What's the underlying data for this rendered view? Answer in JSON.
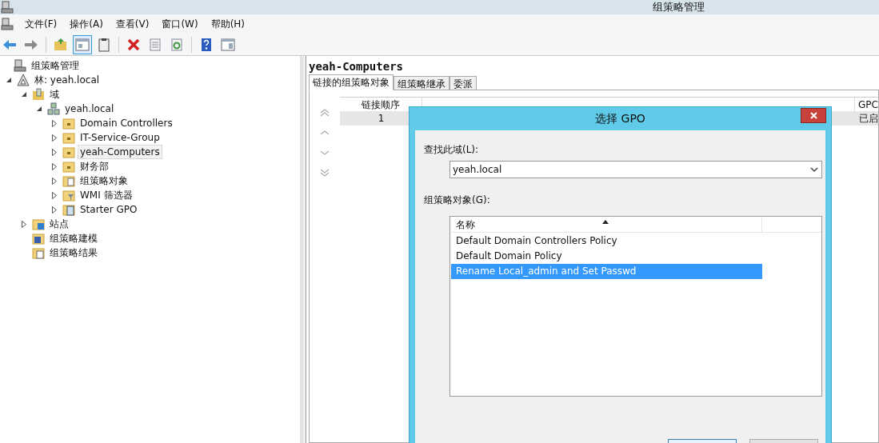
{
  "window": {
    "title": "组策略管理"
  },
  "menu": [
    "文件(F)",
    "操作(A)",
    "查看(V)",
    "窗口(W)",
    "帮助(H)"
  ],
  "toolbar": [
    {
      "kind": "back",
      "pressed": false
    },
    {
      "kind": "forward",
      "pressed": false
    },
    {
      "kind": "sep"
    },
    {
      "kind": "folder-up",
      "pressed": false
    },
    {
      "kind": "tree-pane",
      "pressed": true
    },
    {
      "kind": "clipboard",
      "pressed": false
    },
    {
      "kind": "sep"
    },
    {
      "kind": "delete",
      "pressed": false
    },
    {
      "kind": "properties",
      "pressed": false
    },
    {
      "kind": "refresh",
      "pressed": false
    },
    {
      "kind": "sep"
    },
    {
      "kind": "help",
      "pressed": false
    },
    {
      "kind": "action-pane",
      "pressed": false
    }
  ],
  "tree": [
    {
      "label": "组策略管理",
      "kind": "console",
      "selected": false,
      "children": [
        {
          "label": "林: yeah.local",
          "kind": "forest",
          "expanded": true,
          "selected": false,
          "children": [
            {
              "label": "域",
              "kind": "domains",
              "expanded": true,
              "selected": false,
              "children": [
                {
                  "label": "yeah.local",
                  "kind": "domain",
                  "expanded": true,
                  "selected": false,
                  "children": [
                    {
                      "label": "Domain Controllers",
                      "kind": "ou",
                      "expanded": false,
                      "selected": false
                    },
                    {
                      "label": "IT-Service-Group",
                      "kind": "ou",
                      "expanded": false,
                      "selected": false
                    },
                    {
                      "label": "yeah-Computers",
                      "kind": "ou",
                      "expanded": false,
                      "selected": true
                    },
                    {
                      "label": "财务部",
                      "kind": "ou",
                      "expanded": false,
                      "selected": false
                    },
                    {
                      "label": "组策略对象",
                      "kind": "gpo-folder",
                      "expanded": false,
                      "selected": false
                    },
                    {
                      "label": "WMI 筛选器",
                      "kind": "wmi-folder",
                      "expanded": false,
                      "selected": false
                    },
                    {
                      "label": "Starter GPO",
                      "kind": "starter-folder",
                      "expanded": false,
                      "selected": false
                    }
                  ]
                }
              ]
            },
            {
              "label": "站点",
              "kind": "sites",
              "expanded": false,
              "selected": false
            },
            {
              "label": "组策略建模",
              "kind": "modeling",
              "selected": false
            },
            {
              "label": "组策略结果",
              "kind": "results",
              "selected": false
            }
          ]
        }
      ]
    }
  ],
  "details": {
    "title": "yeah-Computers",
    "tabs": [
      {
        "label": "链接的组策略对象",
        "selected": true
      },
      {
        "label": "组策略继承",
        "selected": false
      },
      {
        "label": "委派",
        "selected": false
      }
    ],
    "table": {
      "columns": [
        {
          "label": "链接顺序"
        },
        {
          "label": "GPC"
        }
      ],
      "rows": [
        {
          "selected": true,
          "cells": [
            "1",
            "已启"
          ]
        }
      ]
    }
  },
  "dialog": {
    "title": "选择 GPO",
    "domain_label": "查找此域(L):",
    "domain_value": "yeah.local",
    "list_label": "组策略对象(G):",
    "list_column": "名称",
    "items": [
      {
        "name": "Default Domain Controllers Policy",
        "selected": false
      },
      {
        "name": "Default Domain Policy",
        "selected": false
      },
      {
        "name": "Rename Local_admin and Set Passwd",
        "selected": true
      }
    ]
  }
}
